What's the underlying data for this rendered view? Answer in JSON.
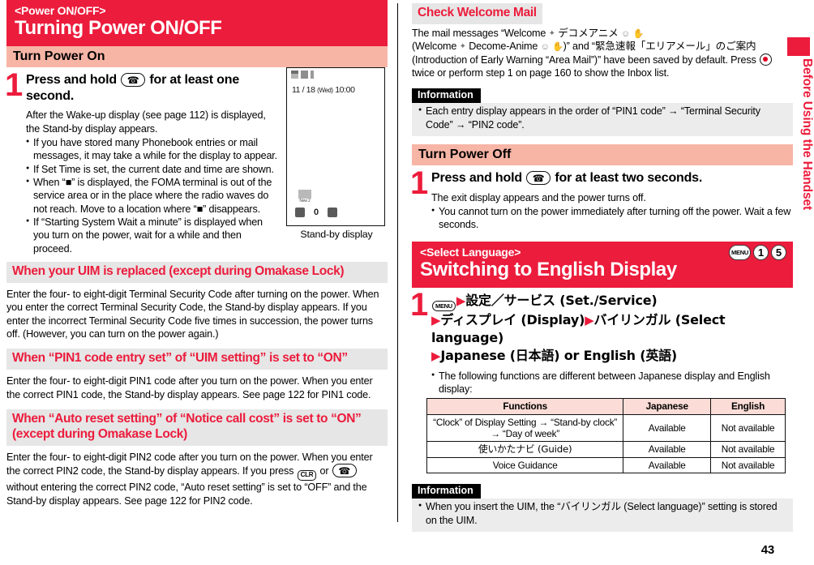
{
  "page_number": "43",
  "side_tab": {
    "label": "Before Using the Handset",
    "accent_color": "#ec1c3c"
  },
  "colors": {
    "banner_red": "#ec1c3c",
    "subhead_pink": "#f7b5a6",
    "grey_head_bg": "#e6e6e6",
    "info_bg": "#ececec",
    "table_header_pink": "#fbdcd6"
  },
  "left_column": {
    "banner": {
      "kicker": "<Power ON/OFF>",
      "title": "Turning Power ON/OFF"
    },
    "subhead": "Turn Power On",
    "step1": {
      "number": "1",
      "title_before_key": "Press and hold",
      "key_icon": "power-handset-key",
      "title_after_key": "for at least one second.",
      "lead": "After the Wake-up display (see page 112) is displayed, the Stand-by display appears.",
      "notes": [
        "If you have stored many Phonebook entries or mail messages, it may take a while for the display to appear.",
        "If Set Time is set, the current date and time are shown.",
        "When “■” is displayed, the FOMA terminal is out of the service area or in the place where the radio waves do not reach. Move to a location where “■” disappears.",
        "If “Starting System Wait a minute” is displayed when you turn on the power, wait for a while and then proceed."
      ]
    },
    "figure": {
      "caption": "Stand-by display",
      "screen": {
        "date_text": "11 / 18",
        "day_of_week": "(Wed)",
        "time_text": "10:00",
        "new_mail_label": "New 2",
        "softkey_center": "0"
      }
    },
    "sections": [
      {
        "heading": "When your UIM is replaced (except during Omakase Lock)",
        "body": "Enter the four- to eight-digit Terminal Security Code after turning on the power. When you enter the correct Terminal Security Code, the Stand-by display appears. If you enter the incorrect Terminal Security Code five times in succession, the power turns off. (However, you can turn on the power again.)"
      },
      {
        "heading": "When “PIN1 code entry set” of “UIM setting” is set to “ON”",
        "body": "Enter the four- to eight-digit PIN1 code after you turn on the power. When you enter the correct PIN1 code, the Stand-by display appears. See page 122 for PIN1 code."
      },
      {
        "heading": "When “Auto reset setting” of “Notice call cost” is set to “ON” (except during Omakase Lock)",
        "body_part1": "Enter the four- to eight-digit PIN2 code after you turn on the power. When you enter the correct PIN2 code, the Stand-by display appears. If you press",
        "key_clr_label": "CLR",
        "body_part2": "or",
        "key_power_label": "power-handset-key",
        "body_part3": "without entering the correct PIN2 code, “Auto reset setting” is set to “OFF” and the Stand-by display appears. See page 122 for PIN2 code."
      }
    ]
  },
  "right_column": {
    "welcome_mail": {
      "heading": "Check Welcome Mail",
      "line1_a": "The mail messages “Welcome",
      "line1_jp": "デコメアニメ",
      "line2_a": "(Welcome",
      "line2_b": "Decome-Anime",
      "line2_c": ")” and “",
      "line2_jp": "緊急速報「エリアメール」のご案内",
      "line3": "(Introduction of Early Warning “Area Mail”)” have been saved by default. Press",
      "line3_key": "center-select-key",
      "line3_tail": "twice or perform step 1 on page 160 to show the Inbox list."
    },
    "information1": {
      "tag": "Information",
      "items": [
        "Each entry display appears in the order of “PIN1 code” → “Terminal Security Code” → “PIN2 code”."
      ]
    },
    "subhead": "Turn Power Off",
    "step1": {
      "number": "1",
      "title_before_key": "Press and hold",
      "key_icon": "power-handset-key",
      "title_after_key": "for at least two seconds.",
      "lead": "The exit display appears and the power turns off.",
      "notes": [
        "You cannot turn on the power immediately after turning off the power. Wait a few seconds."
      ]
    },
    "banner": {
      "kicker": "<Select Language>",
      "title": "Switching to English Display",
      "shortcut_keys": [
        "MENU",
        "1",
        "5"
      ]
    },
    "step_select": {
      "number": "1",
      "menu_key": "MENU",
      "line1": "設定／サービス (Set./Service)",
      "line2a": "ディスプレイ (Display)",
      "line2b": "バイリンガル (Select language)",
      "line3": "Japanese (日本語) or English (英語)",
      "note": "The following functions are different between Japanese display and English display:"
    },
    "table": {
      "headers": [
        "Functions",
        "Japanese",
        "English"
      ],
      "rows": [
        [
          "“Clock” of Display Setting → “Stand-by clock” → “Day of week”",
          "Available",
          "Not available"
        ],
        [
          "使いかたナビ (Guide)",
          "Available",
          "Not available"
        ],
        [
          "Voice Guidance",
          "Available",
          "Not available"
        ]
      ]
    },
    "information2": {
      "tag": "Information",
      "items": [
        "When you insert the UIM, the “バイリンガル (Select language)” setting is stored on the UIM."
      ]
    }
  }
}
